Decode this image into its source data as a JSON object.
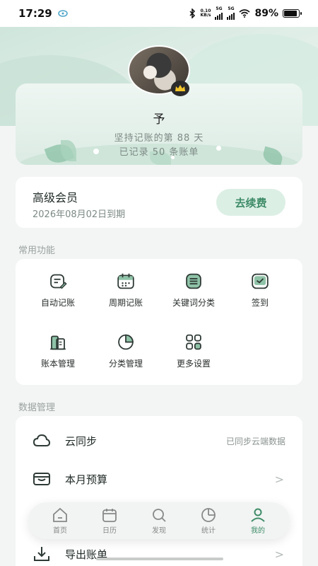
{
  "status_bar": {
    "time": "17:29",
    "net_speed_value": "0.10",
    "net_speed_unit": "KB/s",
    "sim1": "5G",
    "sim2": "5G",
    "battery": "89%"
  },
  "profile": {
    "username": "予",
    "days_text": "坚持记账的第 88 天",
    "records_text": "已记录 50 条账单"
  },
  "membership": {
    "title": "高级会员",
    "expiry": "2026年08月02日到期",
    "renew_label": "去续费"
  },
  "functions": {
    "section_label": "常用功能",
    "items": [
      {
        "label": "自动记账",
        "icon": "auto-note-icon"
      },
      {
        "label": "周期记账",
        "icon": "calendar-icon"
      },
      {
        "label": "关键词分类",
        "icon": "keyword-list-icon"
      },
      {
        "label": "签到",
        "icon": "checkin-icon"
      },
      {
        "label": "账本管理",
        "icon": "ledger-icon"
      },
      {
        "label": "分类管理",
        "icon": "pie-icon"
      },
      {
        "label": "更多设置",
        "icon": "grid-icon"
      }
    ]
  },
  "data_management": {
    "section_label": "数据管理",
    "rows": [
      {
        "label": "云同步",
        "right": "已同步云端数据",
        "icon": "cloud-icon"
      },
      {
        "label": "本月预算",
        "right": ">",
        "icon": "wallet-icon"
      },
      {
        "label": "导出账单",
        "right": ">",
        "icon": "download-icon"
      }
    ]
  },
  "bottom_nav": {
    "items": [
      {
        "label": "首页",
        "icon": "home-icon"
      },
      {
        "label": "日历",
        "icon": "calendar-icon"
      },
      {
        "label": "发现",
        "icon": "search-icon"
      },
      {
        "label": "统计",
        "icon": "pie-chart-icon"
      },
      {
        "label": "我的",
        "icon": "user-icon"
      }
    ],
    "active_index": 4
  },
  "colors": {
    "accent": "#3f8c68",
    "accent_light": "#dcefe5",
    "background": "#f3f5f4"
  }
}
